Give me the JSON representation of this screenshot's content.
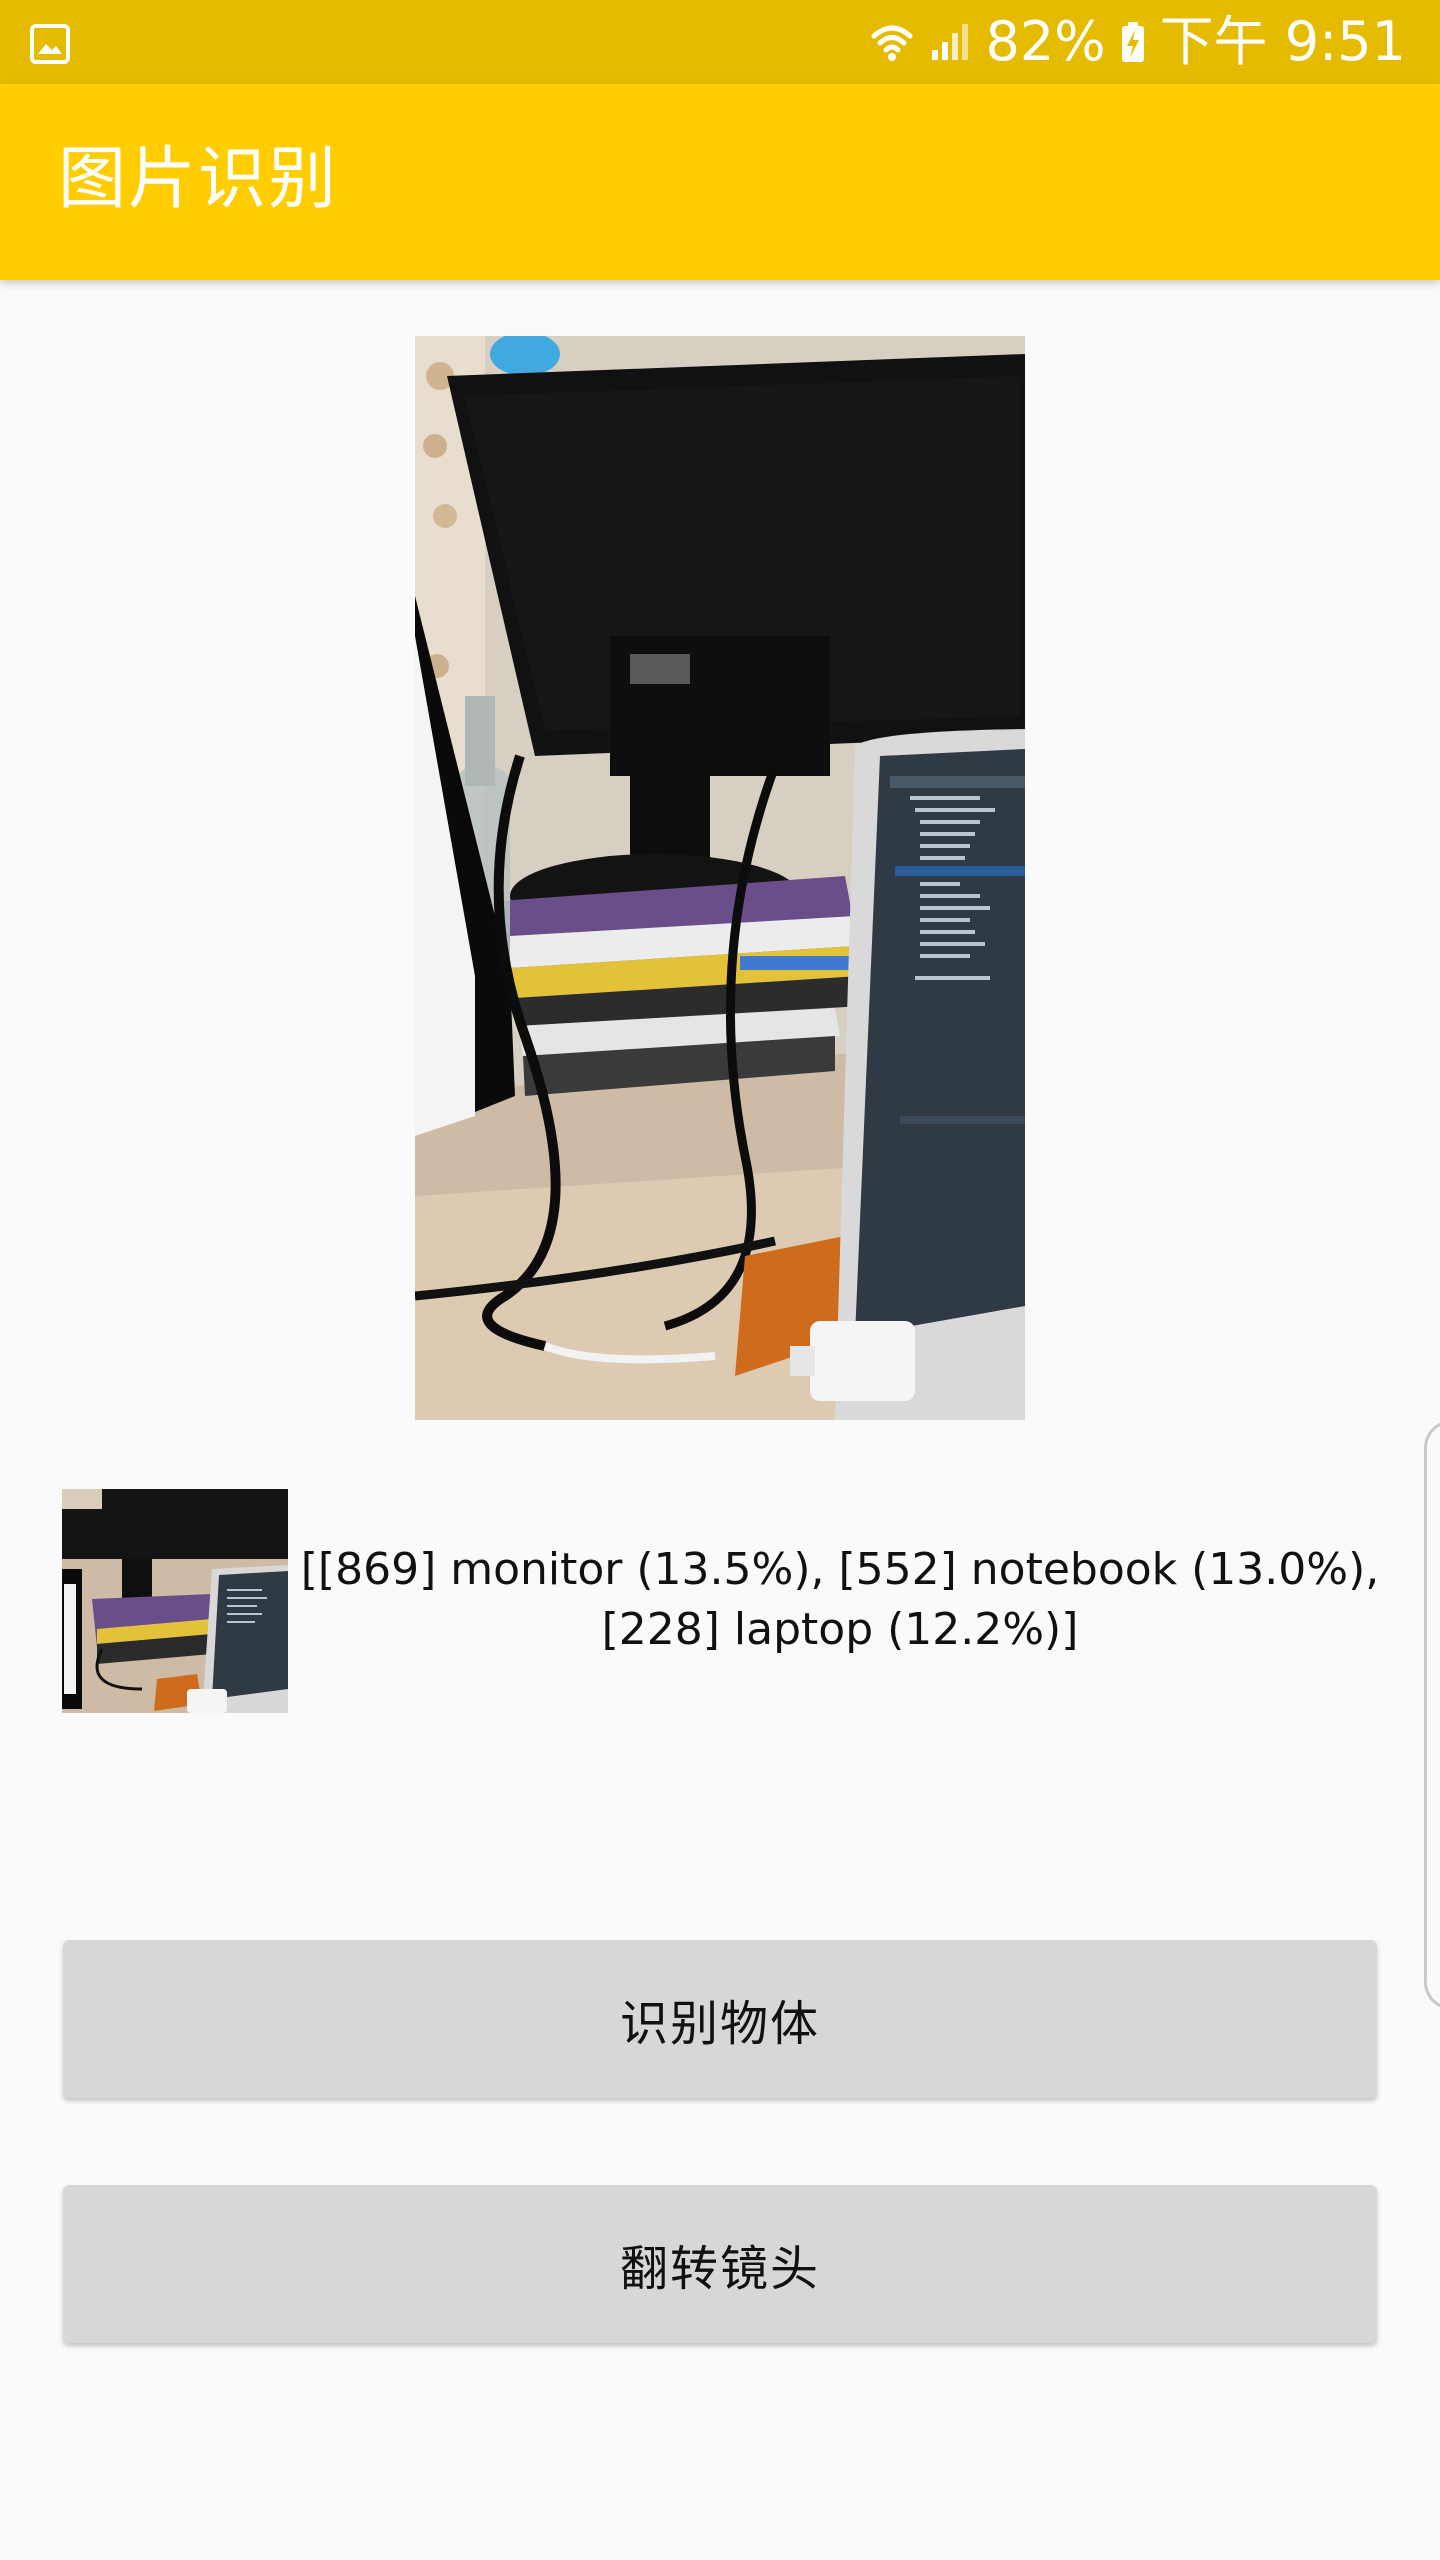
{
  "status_bar": {
    "battery": "82%",
    "time": "下午 9:51",
    "icons": [
      "gallery-icon",
      "wifi-icon",
      "signal-icon",
      "battery-charging-icon"
    ],
    "background": "#e5bb00"
  },
  "app_bar": {
    "title": "图片识别",
    "background": "#ffcd00"
  },
  "main_image": {
    "content": "camera-photo"
  },
  "result": {
    "thumbnail": "thumbnail-image",
    "text": "[[869] monitor (13.5%), [552] notebook (13.0%), [228] laptop (12.2%)]"
  },
  "buttons": {
    "detect_label": "识别物体",
    "flip_label": "翻转镜头",
    "background": "#d6d7d7"
  }
}
